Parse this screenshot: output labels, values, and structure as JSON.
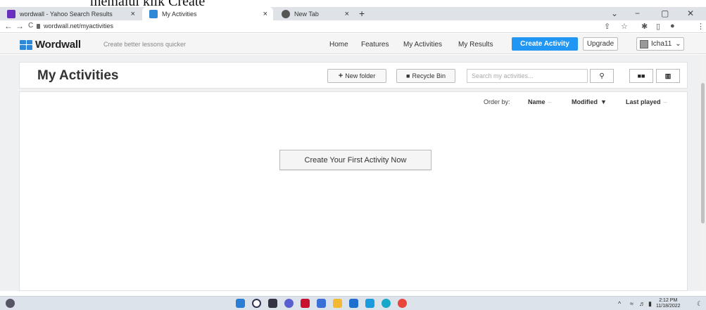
{
  "top_crop_text": "memalui klik Create",
  "browser": {
    "tabs": [
      {
        "title": "wordwall - Yahoo Search Results",
        "close": "×"
      },
      {
        "title": "My Activities",
        "close": "×"
      },
      {
        "title": "New Tab",
        "close": "×"
      }
    ],
    "new_tab": "+",
    "window_controls": {
      "dropdown": "⌄",
      "minimize": "−",
      "maximize": "▢",
      "close": "✕"
    },
    "nav": {
      "back": "←",
      "forward": "→",
      "reload": "C"
    },
    "url": "wordwall.net/myactivities",
    "toolbar_icons": {
      "share": "⇪",
      "star": "☆",
      "extensions": "✱",
      "sidebar": "▯",
      "profile": "●",
      "menu": "⋮"
    }
  },
  "header": {
    "logo_text": "Wordwall",
    "tagline": "Create better lessons quicker",
    "nav": [
      "Home",
      "Features",
      "My Activities",
      "My Results"
    ],
    "create_label": "Create Activity",
    "upgrade_label": "Upgrade",
    "username": "Icha11",
    "user_caret": "⌄"
  },
  "page": {
    "title": "My Activities",
    "new_folder_label": "New folder",
    "recycle_label": "Recycle Bin",
    "search_placeholder": "Search my activities...",
    "order_by_label": "Order by:",
    "order_options": [
      "Name",
      "Modified",
      "Last played"
    ],
    "sort_markers": [
      "–",
      "▼",
      "–"
    ],
    "empty_button": "Create Your First Activity Now"
  },
  "taskbar": {
    "clock_time": "2:12 PM",
    "clock_date": "11/18/2022"
  },
  "colors": {
    "accent": "#2196f3",
    "logo": "#2e88d6"
  }
}
